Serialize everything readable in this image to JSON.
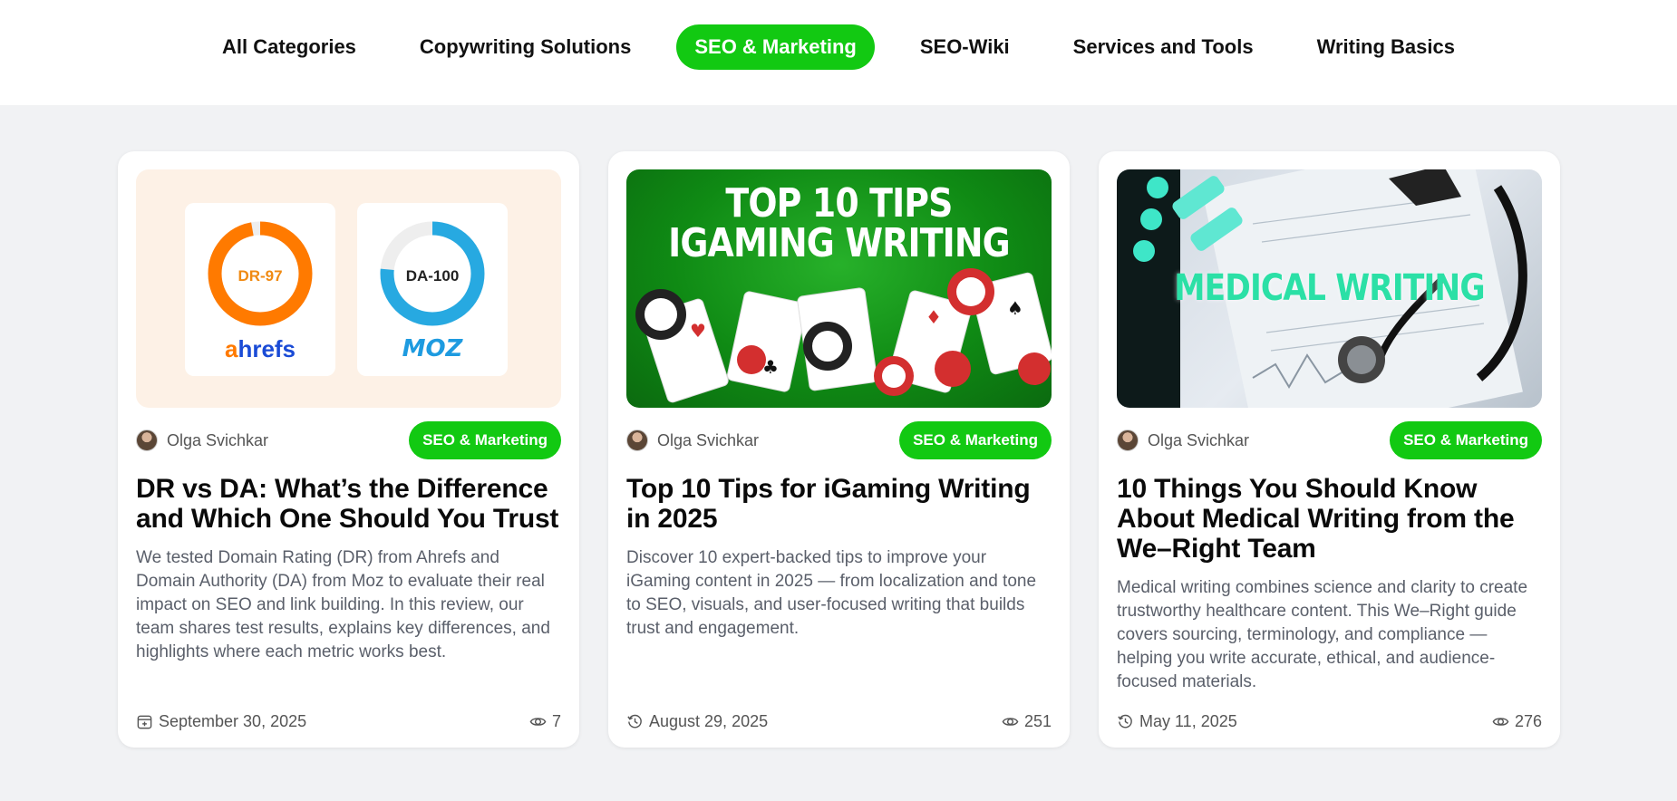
{
  "nav": {
    "items": [
      {
        "label": "All Categories",
        "active": false
      },
      {
        "label": "Copywriting Solutions",
        "active": false
      },
      {
        "label": "SEO & Marketing",
        "active": true
      },
      {
        "label": "SEO-Wiki",
        "active": false
      },
      {
        "label": "Services and Tools",
        "active": false
      },
      {
        "label": "Writing Basics",
        "active": false
      }
    ]
  },
  "colors": {
    "accent": "#12c912",
    "background": "#f1f2f4"
  },
  "cards": [
    {
      "author": "Olga Svichkar",
      "tag": "SEO & Marketing",
      "title": "DR vs DA: What’s the Difference and Which One Should You Trust",
      "description": "We tested Domain Rating (DR) from Ahrefs and Domain Authority (DA) from Moz to evaluate their real impact on SEO and link building. In this review, our team shares test results, explains key differences, and highlights where each metric works best.",
      "date": "September 30, 2025",
      "date_icon": "calendar-icon",
      "views": "7",
      "thumb": {
        "left_label": "DR-97",
        "left_brand_a": "a",
        "left_brand_rest": "hrefs",
        "right_label": "DA-100",
        "right_brand": "MOZ"
      }
    },
    {
      "author": "Olga Svichkar",
      "tag": "SEO & Marketing",
      "title": "Top 10 Tips for iGaming Writing in 2025",
      "description": "Discover 10 expert-backed tips to improve your iGaming content in 2025 — from localization and tone to SEO, visuals, and user-focused writing that builds trust and engagement.",
      "date": "August 29, 2025",
      "date_icon": "history-icon",
      "views": "251",
      "thumb": {
        "line1": "TOP 10 TIPS",
        "line2": "IGAMING WRITING"
      }
    },
    {
      "author": "Olga Svichkar",
      "tag": "SEO & Marketing",
      "title": "10 Things You Should Know About Medical Writing from the We–Right Team",
      "description": "Medical writing combines science and clarity to create trustworthy healthcare content. This We–Right guide covers sourcing, terminology, and compliance — helping you write accurate, ethical, and audience-focused materials.",
      "date": "May 11, 2025",
      "date_icon": "history-icon",
      "views": "276",
      "thumb": {
        "headline": "MEDICAL WRITING"
      }
    }
  ]
}
